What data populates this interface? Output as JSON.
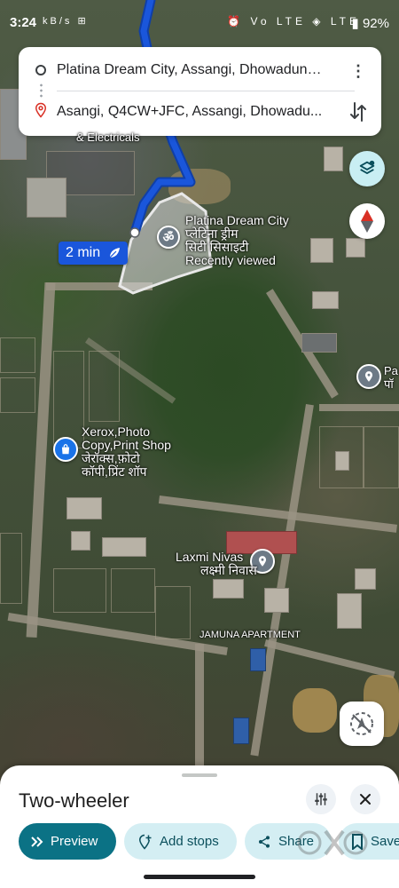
{
  "status_bar": {
    "time": "3:24",
    "left_icons": "kB/s ⊞",
    "right_icons": "⏰ Vo LTE ◈ LTE",
    "battery": "92%"
  },
  "directions": {
    "origin": "Platina Dream City, Assangi, Dhowadung...",
    "destination": "Asangi, Q4CW+JFC, Assangi, Dhowadu...",
    "more": "⋮"
  },
  "map": {
    "eta_label": "2 min",
    "places": {
      "platina_name": "Platina Dream City",
      "platina_hindi1": "प्लेटिना ड्रीम",
      "platina_hindi2": "सिटी सिसाइटी",
      "platina_sub": "Recently viewed",
      "partial_top": "& Electricals",
      "partial_right": "Pa",
      "partial_right_hindi": "पॉ",
      "xerox_line1": "Xerox,Photo",
      "xerox_line2": "Copy,Print Shop",
      "xerox_hindi1": "जेरॉक्स,फ़ोटो",
      "xerox_hindi2": "कॉपी,प्रिंट शॉप",
      "laxmi_name": "Laxmi Nivas",
      "laxmi_hindi": "लक्ष्मी निवास",
      "jamuna": "JAMUNA APARTMENT"
    }
  },
  "sheet": {
    "title": "Two-wheeler",
    "chips": {
      "preview": "Preview",
      "add_stops": "Add stops",
      "share": "Share",
      "save": "Save"
    }
  },
  "colors": {
    "route": "#1a56db",
    "accent_primary": "#0b7285",
    "chip_bg": "#d4eef3"
  }
}
